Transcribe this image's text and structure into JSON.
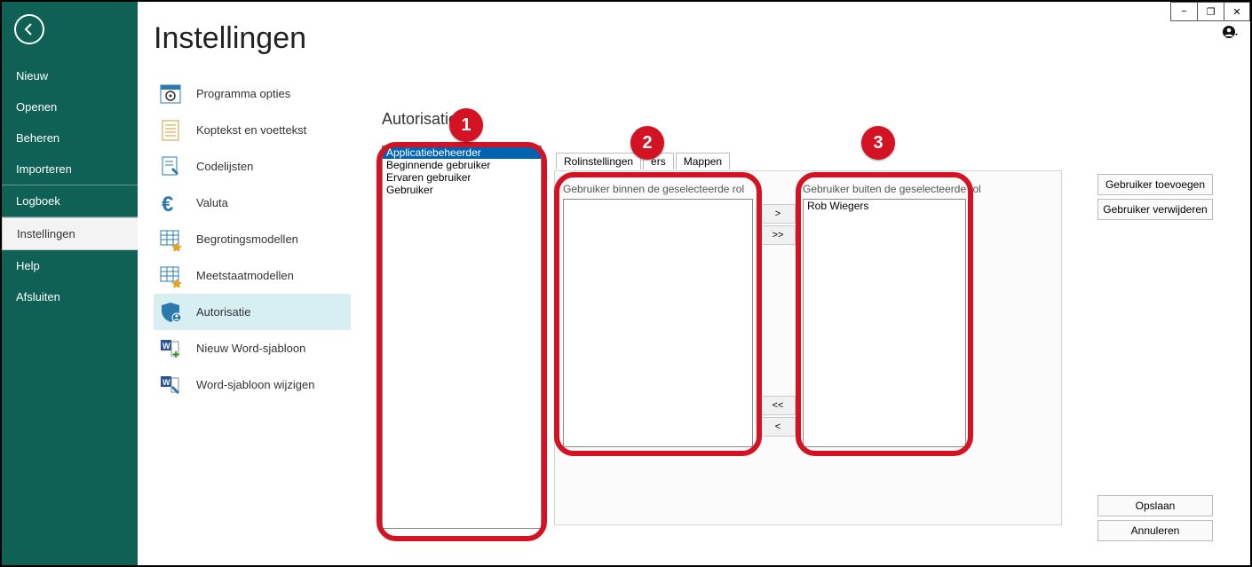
{
  "titlebar": {
    "min": "−",
    "restore": "❐",
    "close": "✕"
  },
  "nav": {
    "items": [
      {
        "label": "Nieuw"
      },
      {
        "label": "Openen"
      },
      {
        "label": "Beheren"
      },
      {
        "label": "Importeren"
      },
      {
        "label": "Logboek"
      },
      {
        "label": "Instellingen",
        "selected": true
      },
      {
        "label": "Help"
      },
      {
        "label": "Afsluiten"
      }
    ]
  },
  "settings": {
    "title": "Instellingen",
    "items": [
      {
        "label": "Programma opties",
        "icon": "gear"
      },
      {
        "label": "Koptekst en voettekst",
        "icon": "doc-lines"
      },
      {
        "label": "Codelijsten",
        "icon": "doc-edit"
      },
      {
        "label": "Valuta",
        "icon": "euro"
      },
      {
        "label": "Begrotingsmodellen",
        "icon": "grid-star"
      },
      {
        "label": "Meetstaatmodellen",
        "icon": "grid-star"
      },
      {
        "label": "Autorisatie",
        "icon": "shield-user",
        "selected": true
      },
      {
        "label": "Nieuw Word-sjabloon",
        "icon": "word-new"
      },
      {
        "label": "Word-sjabloon wijzigen",
        "icon": "word-edit"
      }
    ]
  },
  "main": {
    "section_title": "Autorisatie",
    "roles": [
      {
        "label": "Applicatiebeheerder",
        "selected": true
      },
      {
        "label": "Beginnende gebruiker"
      },
      {
        "label": "Ervaren gebruiker"
      },
      {
        "label": "Gebruiker"
      }
    ],
    "tabs": [
      {
        "label": "Rolinstellingen"
      },
      {
        "label": "Gebruikers",
        "active": true,
        "partially_hidden": "ers"
      },
      {
        "label": "Mappen"
      }
    ],
    "left_list_label": "Gebruiker binnen de geselecteerde rol",
    "right_list_label": "Gebruiker buiten de geselecteerde rol",
    "users_in": [],
    "users_out": [
      {
        "name": "Rob Wiegers"
      }
    ],
    "move_btns": {
      "right_one": ">",
      "right_all": ">>",
      "left_all": "<<",
      "left_one": "<"
    },
    "action_btns": {
      "add": "Gebruiker toevoegen",
      "remove": "Gebruiker verwijderen"
    },
    "bottom_btns": {
      "save": "Opslaan",
      "cancel": "Annuleren"
    }
  },
  "callouts": {
    "c1": "1",
    "c2": "2",
    "c3": "3"
  }
}
